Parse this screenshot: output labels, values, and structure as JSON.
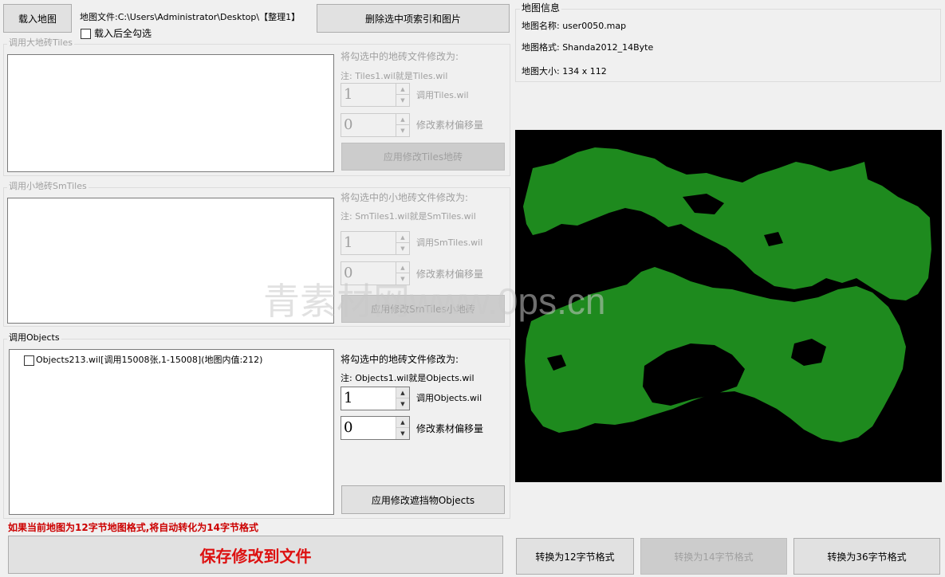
{
  "toolbar": {
    "load_map": "载入地图",
    "map_file_label": "地图文件:C:\\Users\\Administrator\\Desktop\\【整理1】",
    "select_all_on_load": "载入后全勾选",
    "delete_selected": "删除选中项索引和图片"
  },
  "tiles": {
    "title": "调用大地砖Tiles",
    "modify_to": "将勾选中的地砖文件修改为:",
    "note": "注: Tiles1.wil就是Tiles.wil",
    "index_value": "1",
    "index_label": "调用Tiles.wil",
    "offset_value": "0",
    "offset_label": "修改素材偏移量",
    "apply": "应用修改Tiles地砖"
  },
  "smtiles": {
    "title": "调用小地砖SmTiles",
    "modify_to": "将勾选中的小地砖文件修改为:",
    "note": "注: SmTiles1.wil就是SmTiles.wil",
    "index_value": "1",
    "index_label": "调用SmTiles.wil",
    "offset_value": "0",
    "offset_label": "修改素材偏移量",
    "apply": "应用修改SmTiles小地砖"
  },
  "objects": {
    "title": "调用Objects",
    "items": [
      {
        "label": "Objects213.wil[调用15008张,1-15008](地图内值:212)",
        "checked": false
      }
    ],
    "modify_to": "将勾选中的地砖文件修改为:",
    "note": "注: Objects1.wil就是Objects.wil",
    "index_value": "1",
    "index_label": "调用Objects.wil",
    "offset_value": "0",
    "offset_label": "修改素材偏移量",
    "apply": "应用修改遮挡物Objects"
  },
  "warning": "如果当前地图为12字节地图格式,将自动转化为14字节格式",
  "save_button": "保存修改到文件",
  "map_info": {
    "title": "地图信息",
    "name": "地图名称: user0050.map",
    "format": "地图格式: Shanda2012_14Byte",
    "size": "地图大小: 134 x 112"
  },
  "convert": {
    "to12": "转换为12字节格式",
    "to14": "转换为14字节格式",
    "to36": "转换为36字节格式"
  },
  "watermark": "青素材网www.0ps.cn",
  "colors": {
    "map_fill": "#1e8a1e",
    "warning": "#cc0000",
    "save_text": "#dd1111"
  }
}
